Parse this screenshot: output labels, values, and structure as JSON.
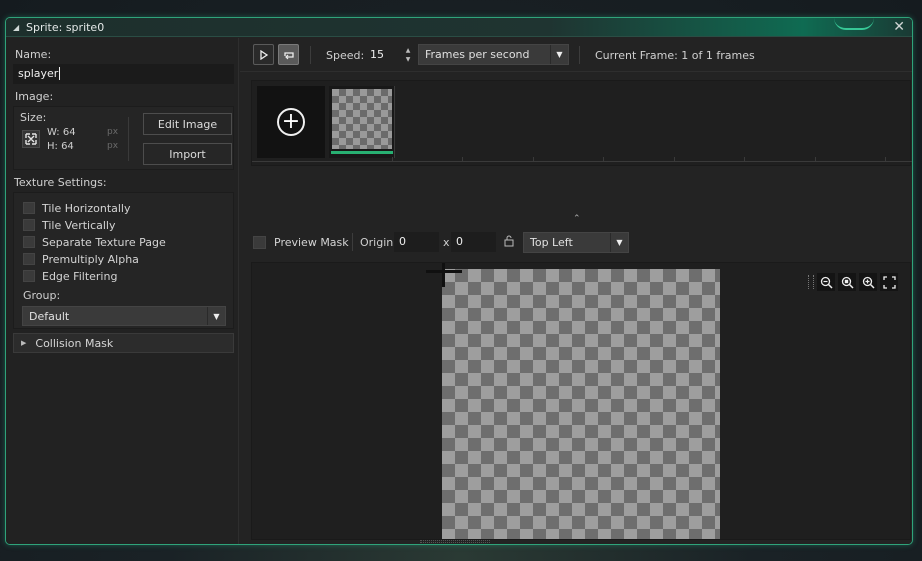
{
  "window": {
    "title": "Sprite: sprite0"
  },
  "left": {
    "name_label": "Name:",
    "name_value": "splayer",
    "image_label": "Image:",
    "size_label": "Size:",
    "width_text": "W: 64",
    "height_text": "H: 64",
    "px_unit_w": "px",
    "px_unit_h": "px",
    "edit_image_label": "Edit Image",
    "import_label": "Import",
    "texture_settings_label": "Texture Settings:",
    "checkboxes": [
      {
        "label": "Tile Horizontally",
        "checked": false
      },
      {
        "label": "Tile Vertically",
        "checked": false
      },
      {
        "label": "Separate Texture Page",
        "checked": false
      },
      {
        "label": "Premultiply Alpha",
        "checked": false
      },
      {
        "label": "Edge Filtering",
        "checked": false
      }
    ],
    "group_label": "Group:",
    "group_value": "Default",
    "collision_mask_label": "Collision Mask"
  },
  "toolbar": {
    "speed_label": "Speed:",
    "speed_value": "15",
    "speed_unit": "Frames per second",
    "current_frame": "Current Frame: 1 of 1 frames"
  },
  "mask": {
    "preview_mask_label": "Preview Mask",
    "preview_mask_checked": false,
    "origin_label": "Origin:",
    "origin_x": "0",
    "origin_sep": "x",
    "origin_y": "0",
    "origin_preset": "Top Left"
  },
  "colors": {
    "accent": "#2fa37a",
    "frame_selected": "#28b072",
    "panel_bg": "#232323"
  }
}
